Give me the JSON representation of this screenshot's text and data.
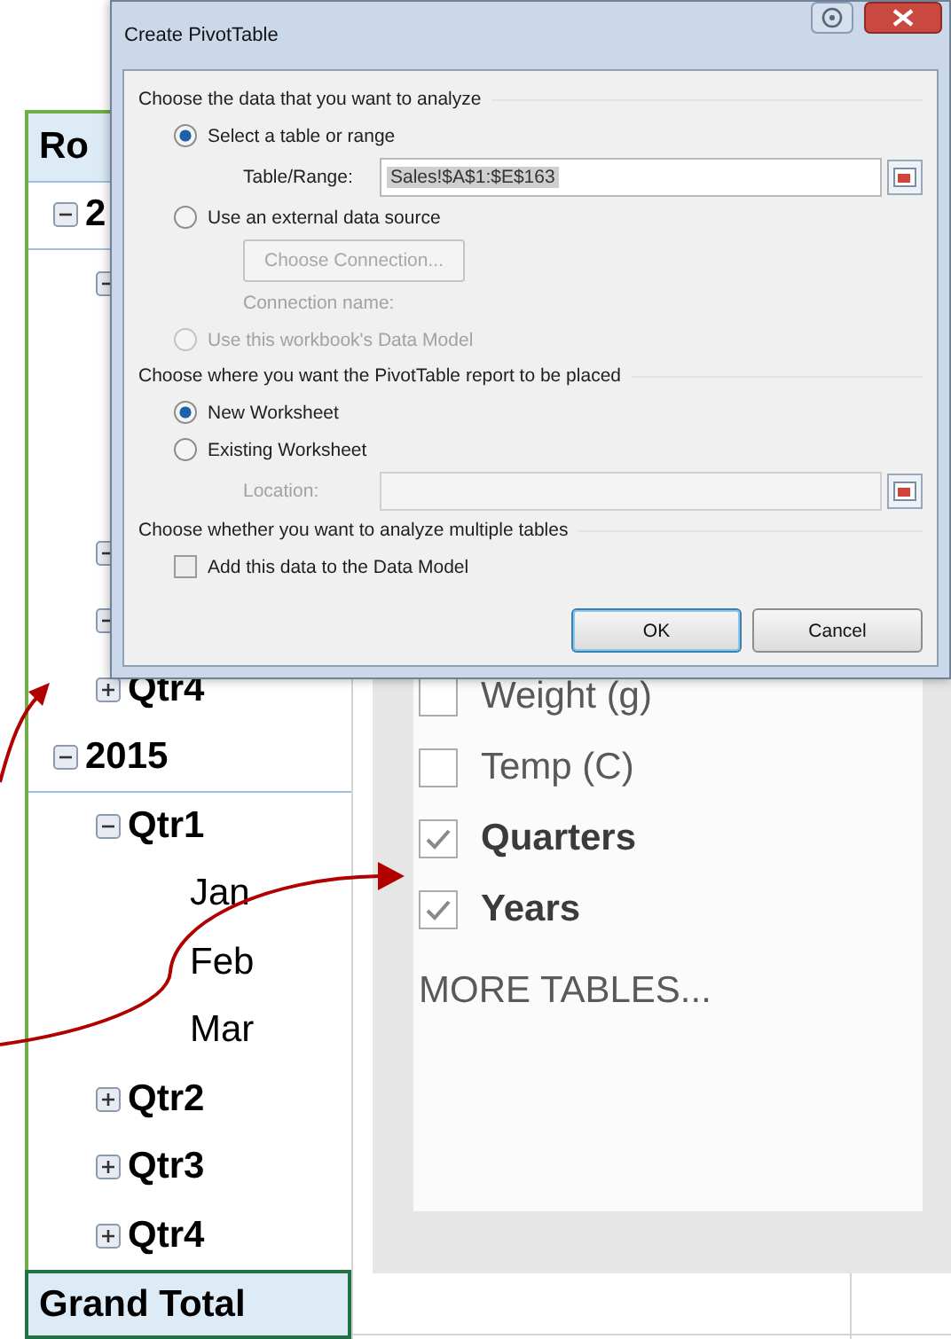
{
  "pivot_table": {
    "header": "Ro",
    "rows": [
      {
        "label": "2",
        "expanded": true,
        "children": [
          {
            "expanded": true
          },
          {
            "expanded": true
          },
          {
            "expanded": true
          },
          {
            "label": "Qtr4",
            "expanded": false
          }
        ]
      },
      {
        "label": "2015",
        "expanded": true,
        "children": [
          {
            "label": "Qtr1",
            "expanded": true,
            "children": [
              {
                "label": "Jan"
              },
              {
                "label": "Feb"
              },
              {
                "label": "Mar"
              }
            ]
          },
          {
            "label": "Qtr2",
            "expanded": false
          },
          {
            "label": "Qtr3",
            "expanded": false
          },
          {
            "label": "Qtr4",
            "expanded": false
          }
        ]
      }
    ],
    "grand_total": "Grand Total"
  },
  "field_list": {
    "fields": [
      {
        "label": "Weight (g)",
        "checked": false
      },
      {
        "label": "Temp (C)",
        "checked": false
      },
      {
        "label": "Quarters",
        "checked": true
      },
      {
        "label": "Years",
        "checked": true
      }
    ],
    "more_link": "MORE TABLES..."
  },
  "dialog": {
    "title": "Create PivotTable",
    "sections": [
      {
        "heading": "Choose the data that you want to analyze",
        "items": [
          {
            "kind": "radio",
            "label": "Select a table or range",
            "selected": true,
            "disabled": false
          },
          {
            "kind": "field",
            "label": "Table/Range:",
            "value": "Sales!$A$1:$E$163",
            "disabled": false
          },
          {
            "kind": "radio",
            "label": "Use an external data source",
            "selected": false,
            "disabled": false
          },
          {
            "kind": "button",
            "label": "Choose Connection...",
            "disabled": true
          },
          {
            "kind": "note",
            "label": "Connection name:",
            "disabled": true
          },
          {
            "kind": "radio",
            "label": "Use this workbook's Data Model",
            "selected": false,
            "disabled": true
          }
        ]
      },
      {
        "heading": "Choose where you want the PivotTable report to be placed",
        "items": [
          {
            "kind": "radio",
            "label": "New Worksheet",
            "selected": true,
            "disabled": false
          },
          {
            "kind": "radio",
            "label": "Existing Worksheet",
            "selected": false,
            "disabled": false
          },
          {
            "kind": "field",
            "label": "Location:",
            "disabled": true
          }
        ]
      },
      {
        "heading": "Choose whether you want to analyze multiple tables",
        "items": [
          {
            "kind": "checkbox",
            "label": "Add this data to the Data Model",
            "checked": false,
            "disabled": false
          }
        ]
      }
    ],
    "buttons": [
      {
        "label": "OK",
        "default": true
      },
      {
        "label": "Cancel",
        "default": false
      }
    ]
  }
}
